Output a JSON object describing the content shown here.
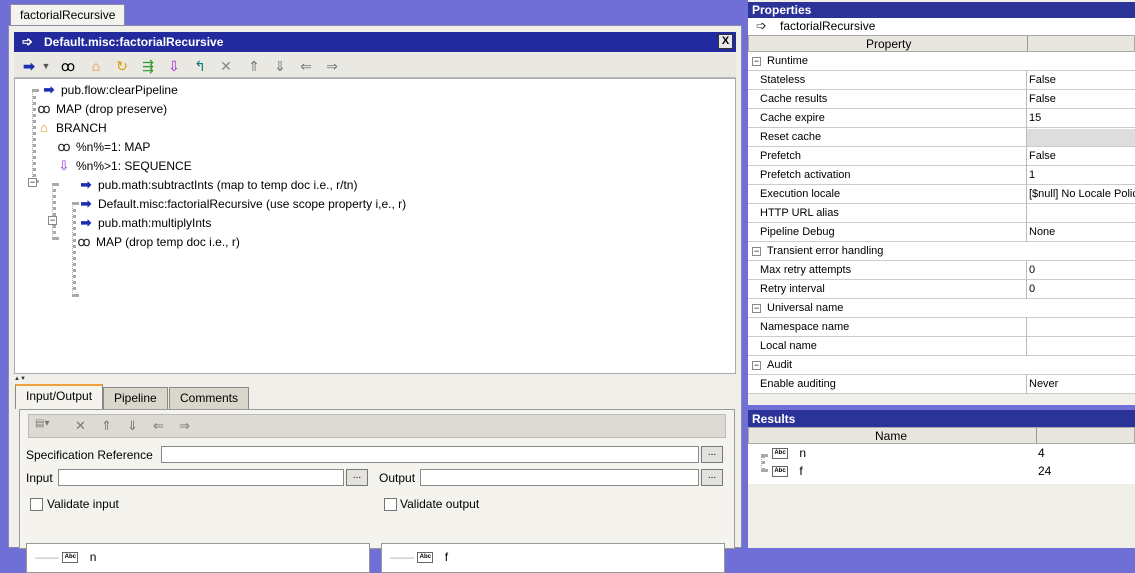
{
  "window": {
    "tab_label": "factorialRecursive"
  },
  "editor": {
    "title": "Default.misc:factorialRecursive",
    "close_label": "X",
    "toolbar_icons": [
      "invoke-icon",
      "dropdown-arrow-icon",
      "map-icon",
      "branch-icon",
      "loop-icon",
      "repeat-icon",
      "sequence-icon",
      "exit-icon",
      "disable-icon",
      "move-up-icon",
      "move-down-icon",
      "move-left-icon",
      "move-right-icon"
    ]
  },
  "tree": [
    {
      "label": "pub.flow:clearPipeline",
      "icon": "invoke-arrow-icon"
    },
    {
      "label": "MAP (drop preserve)",
      "icon": "map-icon"
    },
    {
      "label": "BRANCH",
      "icon": "branch-icon"
    },
    {
      "label": "%n%=1: MAP",
      "icon": "map-icon"
    },
    {
      "label": "%n%>1: SEQUENCE",
      "icon": "sequence-icon"
    },
    {
      "label": "pub.math:subtractInts (map to temp doc i.e., r/tn)",
      "icon": "invoke-arrow-icon"
    },
    {
      "label": "Default.misc:factorialRecursive (use scope property i,e., r)",
      "icon": "invoke-arrow-icon"
    },
    {
      "label": "pub.math:multiplyInts",
      "icon": "invoke-arrow-icon"
    },
    {
      "label": "MAP (drop temp doc i.e., r)",
      "icon": "map-icon"
    }
  ],
  "bottom_tabs": [
    "Input/Output",
    "Pipeline",
    "Comments"
  ],
  "io": {
    "spec_ref_label": "Specification Reference",
    "input_label": "Input",
    "output_label": "Output",
    "browse_label": "...",
    "validate_input_label": "Validate input",
    "validate_output_label": "Validate output",
    "input_var": "n",
    "output_var": "f",
    "abc_label": "Abc"
  },
  "properties": {
    "header": "Properties",
    "subject": "factorialRecursive",
    "col_property": "Property",
    "rows": [
      {
        "type": "cat",
        "key": "Runtime"
      },
      {
        "key": "Stateless",
        "value": "False"
      },
      {
        "key": "Cache results",
        "value": "False"
      },
      {
        "key": "Cache expire",
        "value": "15"
      },
      {
        "key": "Reset cache",
        "value": "",
        "grey": true
      },
      {
        "key": "Prefetch",
        "value": "False"
      },
      {
        "key": "Prefetch activation",
        "value": "1"
      },
      {
        "key": "Execution locale",
        "value": "[$null] No Locale Policy"
      },
      {
        "key": "HTTP URL alias",
        "value": ""
      },
      {
        "key": "Pipeline Debug",
        "value": "None"
      },
      {
        "type": "cat",
        "key": "Transient error handling"
      },
      {
        "key": "Max retry attempts",
        "value": "0"
      },
      {
        "key": "Retry interval",
        "value": "0"
      },
      {
        "type": "cat",
        "key": "Universal name"
      },
      {
        "key": "Namespace name",
        "value": ""
      },
      {
        "key": "Local name",
        "value": ""
      },
      {
        "type": "cat",
        "key": "Audit"
      },
      {
        "key": "Enable auditing",
        "value": "Never"
      }
    ]
  },
  "results": {
    "header": "Results",
    "col_name": "Name",
    "items": [
      {
        "name": "n",
        "value": "4"
      },
      {
        "name": "f",
        "value": "24"
      }
    ]
  }
}
